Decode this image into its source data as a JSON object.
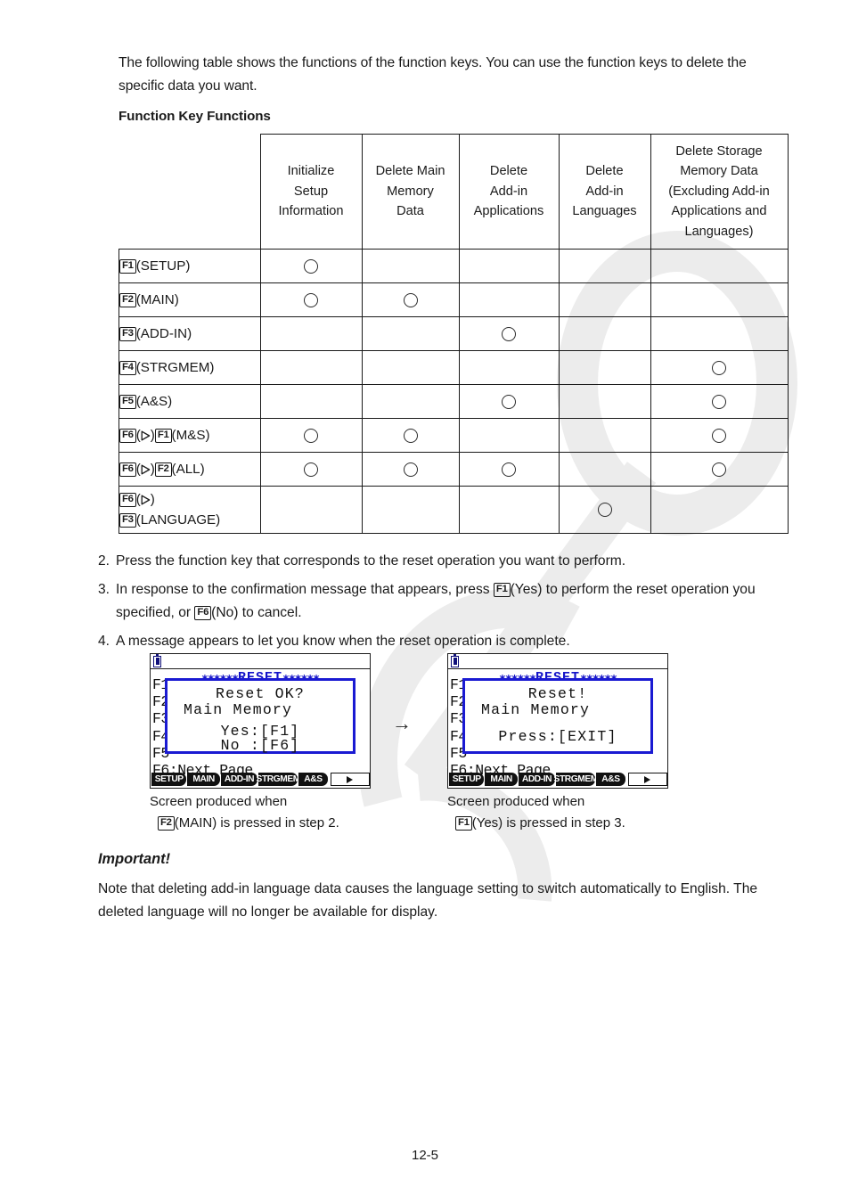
{
  "intro": {
    "paragraph": "The following table shows the functions of the function keys. You can use the function keys to delete the specific data you want."
  },
  "section": {
    "title": "Function Key Functions"
  },
  "table": {
    "columns": [
      "Initialize\nSetup\nInformation",
      "Delete Main\nMemory\nData",
      "Delete\nAdd-in\nApplications",
      "Delete\nAdd-in\nLanguages",
      "Delete Storage\nMemory Data\n(Excluding Add-in\nApplications and\nLanguages)"
    ],
    "rows": [
      {
        "key": "F1",
        "label": "(SETUP)",
        "marks": [
          true,
          false,
          false,
          false,
          false
        ]
      },
      {
        "key": "F2",
        "label": "(MAIN)",
        "marks": [
          true,
          true,
          false,
          false,
          false
        ]
      },
      {
        "key": "F3",
        "label": "(ADD-IN)",
        "marks": [
          false,
          false,
          true,
          false,
          false
        ]
      },
      {
        "key": "F4",
        "label": "(STRGMEM)",
        "marks": [
          false,
          false,
          false,
          false,
          true
        ]
      },
      {
        "key": "F5",
        "label": "(A&S)",
        "marks": [
          false,
          false,
          true,
          false,
          true
        ]
      },
      {
        "key": "F6",
        "label": "(M&S)",
        "key2": "F1",
        "arrow": true,
        "marks": [
          true,
          true,
          false,
          false,
          true
        ]
      },
      {
        "key": "F6",
        "label": "(ALL)",
        "key2": "F2",
        "arrow": true,
        "marks": [
          true,
          true,
          true,
          false,
          true
        ]
      },
      {
        "key": "F6",
        "label": "(LANGUAGE)",
        "key2": "F3",
        "arrow": true,
        "twoline": true,
        "marks": [
          false,
          false,
          false,
          true,
          false
        ]
      }
    ],
    "mark_symbol": "circle"
  },
  "steps": [
    {
      "num": "2.",
      "text": "Press the function key that corresponds to the reset operation you want to perform."
    },
    {
      "num": "3.",
      "pre": "In response to the confirmation message that appears, press ",
      "key1": "F1",
      "mid1": "(Yes) to perform the reset operation you specified, or ",
      "key2": "F6",
      "post": "(No) to cancel."
    },
    {
      "num": "4.",
      "text": "A message appears to let you know when the reset operation is complete."
    }
  ],
  "screens": {
    "arrow_between": "→",
    "lcd1": {
      "title_left_stars": "∗∗∗∗∗∗",
      "title": "RESET",
      "title_right_stars": "∗∗∗∗∗∗",
      "menu_lines": [
        "F1",
        "F2",
        "F3",
        "F4",
        "F5",
        "F6:Next Page"
      ],
      "dialog": {
        "line1": "Reset OK?",
        "line2": "Main Memory",
        "line3": "Yes:[F1]",
        "line4": "No :[F6]"
      },
      "fkeys": [
        "SETUP",
        "MAIN",
        "ADD-IN",
        "STRGMEM",
        "A&S"
      ],
      "fkey_next": "▷"
    },
    "lcd2": {
      "title_left_stars": "∗∗∗∗∗∗",
      "title": "RESET",
      "title_right_stars": "∗∗∗∗∗∗",
      "menu_lines": [
        "F1",
        "F2",
        "F3",
        "F4",
        "F5",
        "F6:Next Page"
      ],
      "dialog": {
        "line1": "Reset!",
        "line2": "Main Memory",
        "line3": "Press:[EXIT]"
      },
      "fkeys": [
        "SETUP",
        "MAIN",
        "ADD-IN",
        "STRGMEM",
        "A&S"
      ],
      "fkey_next": "▷"
    }
  },
  "captions": {
    "cap1_line1": "Screen produced when",
    "cap1_key": "F2",
    "cap1_line2": "(MAIN) is pressed in step 2.",
    "cap2_line1": "Screen produced when",
    "cap2_key": "F1",
    "cap2_line2": "(Yes) is pressed in step 3."
  },
  "important": {
    "heading": "Important!",
    "body": "Note that deleting add-in language data causes the language setting to switch automatically to English. The deleted language will no longer be available for display."
  },
  "footer": {
    "page_number": "12-5"
  },
  "colors": {
    "lcd_blue": "#1a1ad2",
    "text": "#1a1a1a",
    "watermark": "#ededed"
  }
}
